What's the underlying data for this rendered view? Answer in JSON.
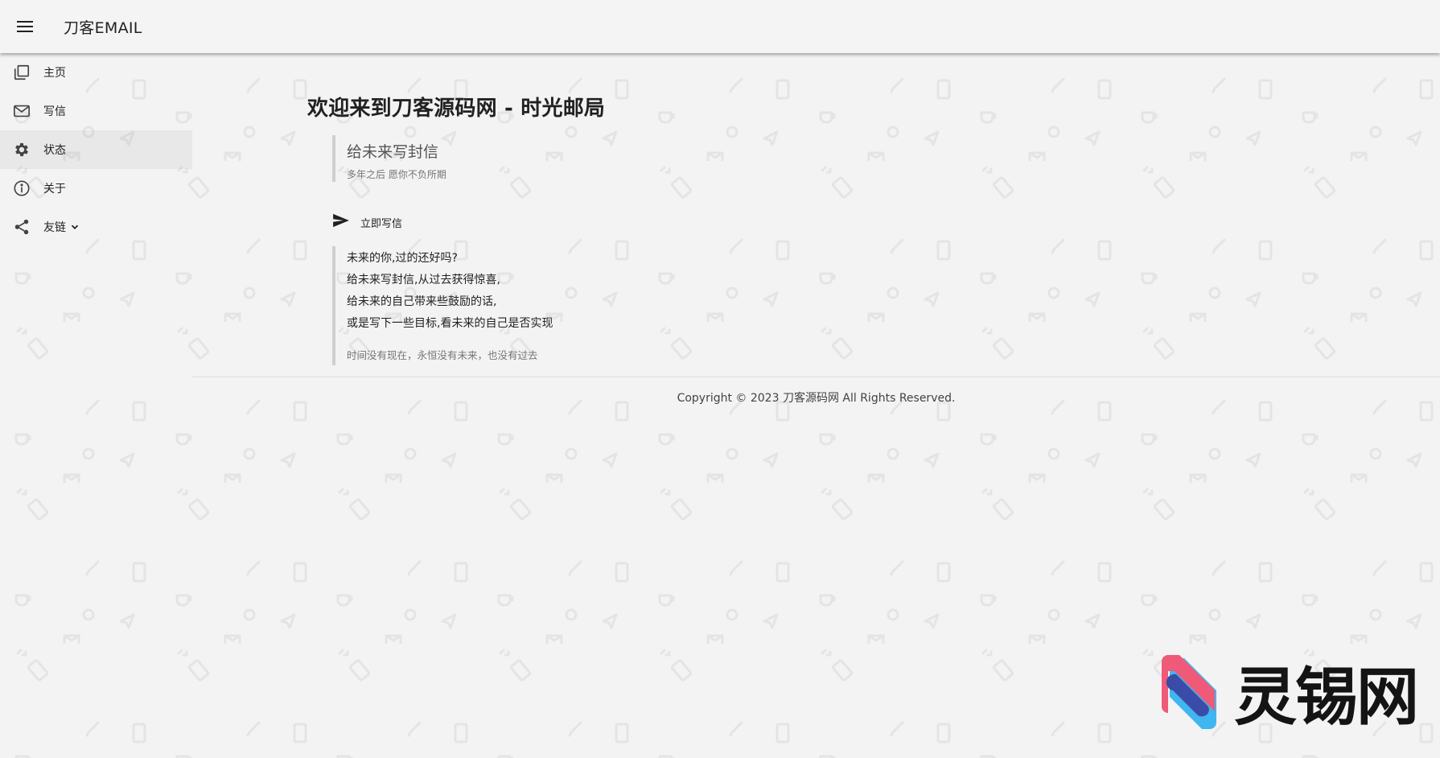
{
  "appbar": {
    "title": "刀客EMAIL",
    "menu_icon": "menu-icon"
  },
  "drawer": {
    "items": [
      {
        "label": "主页",
        "icon": "pages-icon"
      },
      {
        "label": "写信",
        "icon": "mail-icon"
      },
      {
        "label": "状态",
        "icon": "gear-icon",
        "active": true
      },
      {
        "label": "关于",
        "icon": "info-icon"
      },
      {
        "label": "友链",
        "icon": "share-icon",
        "has_dropdown": true
      }
    ]
  },
  "main": {
    "title": "欢迎来到刀客源码网 - 时光邮局",
    "quote_heading": "给未来写封信",
    "quote_sub": "多年之后 愿你不负所期",
    "write_button": "立即写信",
    "poem_lines": [
      "未来的你,过的还好吗?",
      "给未来写封信,从过去获得惊喜,",
      "给未来的自己带来些鼓励的话,",
      "或是写下一些目标,看未来的自己是否实现"
    ],
    "poem_footer": "时间没有现在，永恒没有未来，也没有过去"
  },
  "footer": {
    "copyright": "Copyright © 2023 刀客源码网 All Rights Reserved."
  },
  "watermark": {
    "text": "灵锡网"
  },
  "colors": {
    "background": "#f3f3f3",
    "text": "#212121",
    "muted": "#757575",
    "quote_border": "#cfcfcf",
    "logo_pink": "#ef5a78",
    "logo_blue": "#3fb6f0",
    "logo_navy": "#3b4ba8"
  }
}
